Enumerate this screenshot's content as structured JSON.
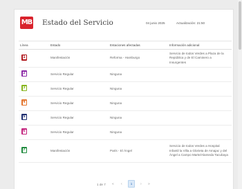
{
  "header": {
    "logo_text": "MB",
    "title": "Estado del Servicio",
    "date": "04 junio 2025",
    "update": "Actualización: 21:50"
  },
  "table": {
    "columns": [
      "Línea",
      "Estado",
      "Estaciones afectadas",
      "Información adicional"
    ],
    "rows": [
      {
        "line": "1",
        "color": "#b0181e",
        "status": "Manifestación",
        "stations": "Reforma - Hamburgo",
        "info": "Servicio de todos Verdes a Plaza de la República y de El Caminero a Insurgentes"
      },
      {
        "line": "2",
        "color": "#8c2aa6",
        "status": "Servicio Regular",
        "stations": "Ninguna",
        "info": ""
      },
      {
        "line": "3",
        "color": "#86b51e",
        "status": "Servicio Regular",
        "stations": "Ninguna",
        "info": ""
      },
      {
        "line": "4",
        "color": "#e4752e",
        "status": "Servicio Regular",
        "stations": "Ninguna",
        "info": ""
      },
      {
        "line": "5",
        "color": "#1d2d6e",
        "status": "Servicio Regular",
        "stations": "Ninguna",
        "info": ""
      },
      {
        "line": "6",
        "color": "#c3227d",
        "status": "Servicio Regular",
        "stations": "Ninguna",
        "info": ""
      },
      {
        "line": "7",
        "color": "#1e8a3c",
        "status": "Manifestación",
        "stations": "París - El Ángel",
        "info": "Servicio de todos Verdes a Hospital Infantil la Villa a Glorieta de Amajac y del Ángel a Campo Marte/Alameda Tacubaya"
      }
    ]
  },
  "pagination": {
    "page_count": "1 de 7",
    "first": "«",
    "prev": "‹",
    "current": "1",
    "next": "›",
    "last": "»"
  }
}
